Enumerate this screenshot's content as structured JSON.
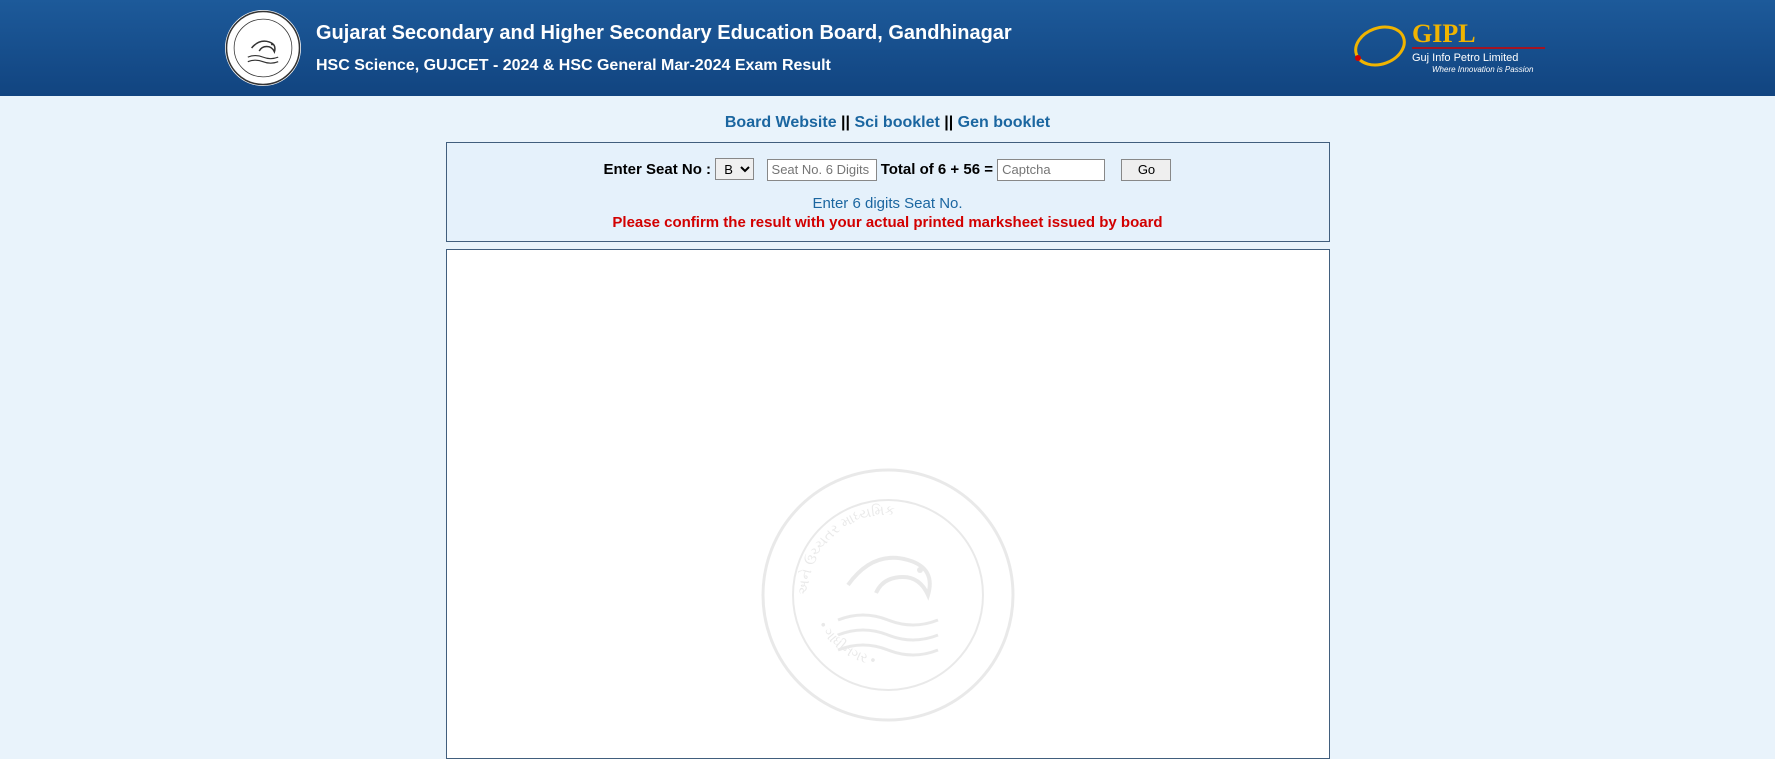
{
  "header": {
    "title": "Gujarat Secondary and Higher Secondary Education Board, Gandhinagar",
    "subtitle": "HSC Science, GUJCET - 2024 & HSC General Mar-2024 Exam Result"
  },
  "nav": {
    "board_website": "Board Website",
    "sci_booklet": "Sci booklet",
    "gen_booklet": "Gen booklet",
    "separator": " || "
  },
  "form": {
    "seat_label": "Enter Seat No : ",
    "select_options": [
      "B"
    ],
    "select_value": "B",
    "seat_placeholder": "Seat No. 6 Digits",
    "captcha_label": "Total of 6 + 56 = ",
    "captcha_placeholder": "Captcha",
    "go_label": "Go"
  },
  "messages": {
    "blue": "Enter 6 digits Seat No.",
    "red": "Please confirm the result with your actual printed marksheet issued by board"
  },
  "gipl": {
    "brand": "GIPL",
    "tagline1": "Guj Info Petro Limited",
    "tagline2": "Where Innovation is Passion"
  }
}
